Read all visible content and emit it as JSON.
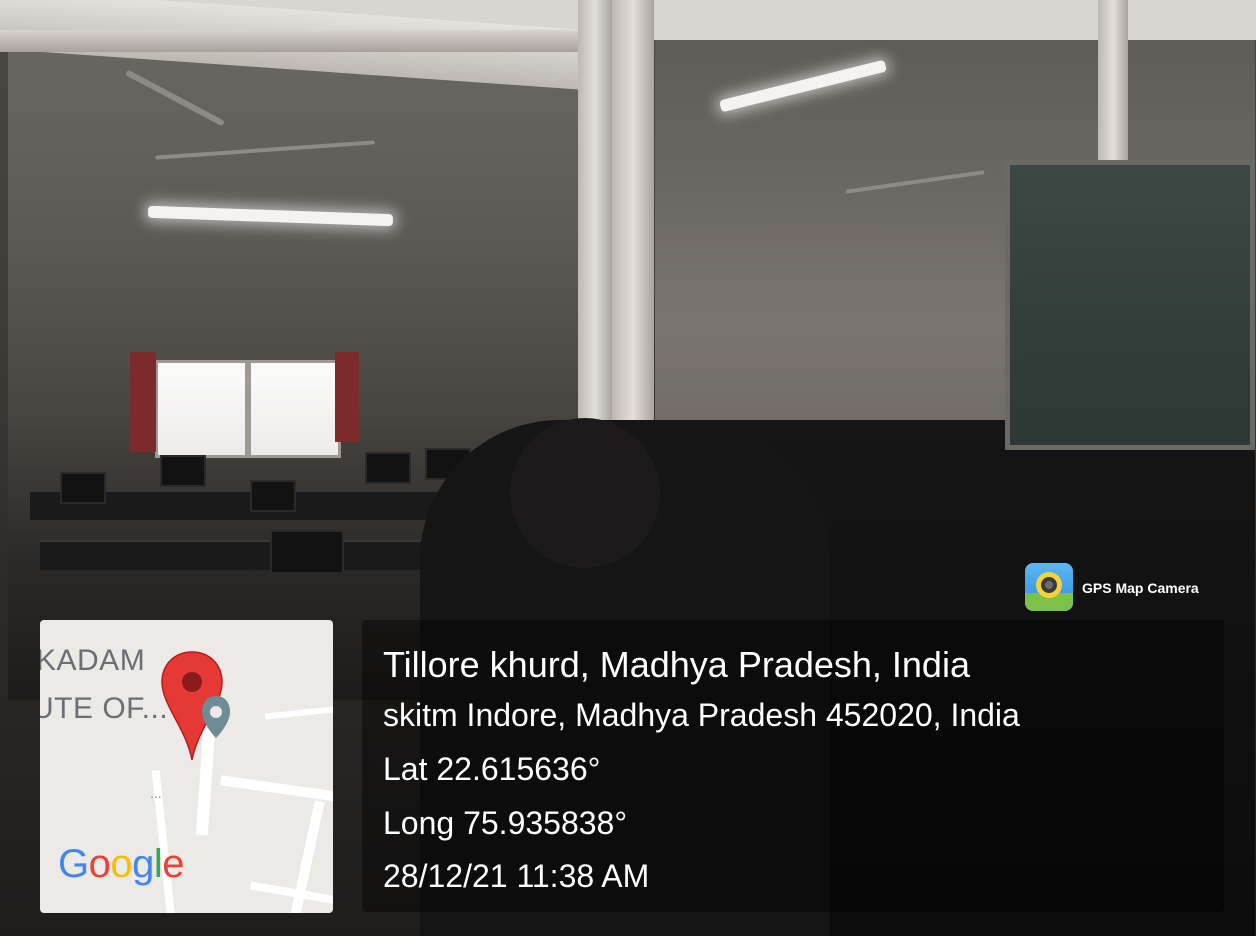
{
  "overlay": {
    "app_badge": {
      "name": "GPS Map Camera",
      "icon": "camera-lens-icon"
    },
    "map": {
      "label_line1": "KADAM",
      "label_line2": "UTE OF...",
      "dots": "...",
      "logo": "Google",
      "pin_icon": "map-pin-icon"
    },
    "location": {
      "place": "Tillore khurd, Madhya Pradesh, India",
      "address": "skitm Indore, Madhya Pradesh 452020, India",
      "lat": "Lat 22.615636°",
      "long": "Long 75.935838°",
      "datetime": "28/12/21 11:38 AM"
    },
    "colors": {
      "pin": "#e53935",
      "google_blue": "#4285f4",
      "google_red": "#ea4335",
      "google_yellow": "#fbbc05",
      "google_green": "#34a853"
    }
  }
}
